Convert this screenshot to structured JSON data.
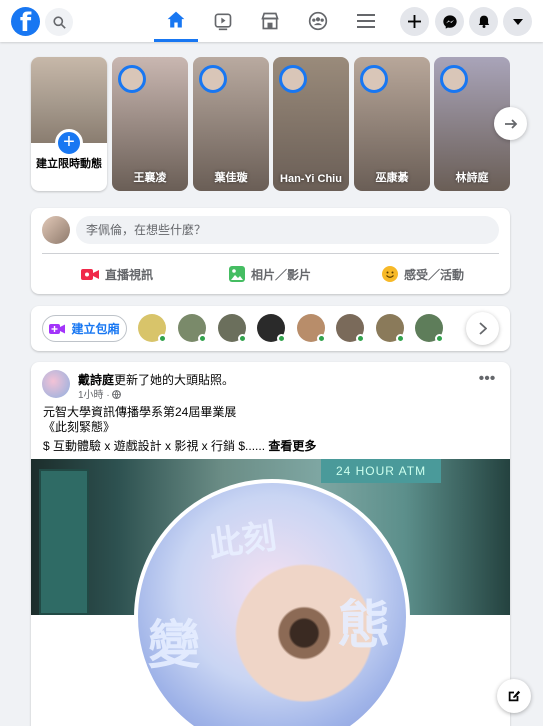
{
  "nav": {
    "logo": "f",
    "icons": [
      "search-icon",
      "home-icon",
      "watch-icon",
      "marketplace-icon",
      "groups-icon",
      "menu-icon",
      "create-icon",
      "messenger-icon",
      "notifications-icon",
      "account-icon"
    ],
    "brand_color": "#1877f2"
  },
  "stories": {
    "create_label": "建立限時動態",
    "items": [
      {
        "name": "王襄凌",
        "bg": "#c9b7b1"
      },
      {
        "name": "葉佳璇",
        "bg": "#b9aaa0"
      },
      {
        "name": "Han-Yi Chiu",
        "bg": "#9a8b7b"
      },
      {
        "name": "巫康綦",
        "bg": "#b8a79a"
      },
      {
        "name": "林詩庭",
        "bg": "#a9a4b9"
      }
    ]
  },
  "composer": {
    "placeholder": "李佩倫，在想些什麼？",
    "live": "直播視訊",
    "photo": "相片／影片",
    "feeling": "感受／活動"
  },
  "rooms": {
    "create_label": "建立包廂",
    "avatars": [
      "#d8c46a",
      "#7a8a6a",
      "#6b6f5c",
      "#2a2a2a",
      "#b88d6a",
      "#7a6a5a",
      "#8a7a5a",
      "#5e7d5a",
      "#9aa2b3"
    ]
  },
  "post": {
    "author": "戴詩庭",
    "action": "更新了她的大頭貼照。",
    "time": "1小時 · ",
    "line1": "元智大學資訊傳播學系第24屆畢業展",
    "line2": "《此刻緊態》",
    "line3": "$ 互動體驗 x 遊戲設計 x 影視 x 行銷 $......",
    "see_more": "查看更多",
    "atm_sign": "24 HOUR ATM",
    "pic_text1": "此刻",
    "pic_text2": "變",
    "pic_text3": "態"
  }
}
